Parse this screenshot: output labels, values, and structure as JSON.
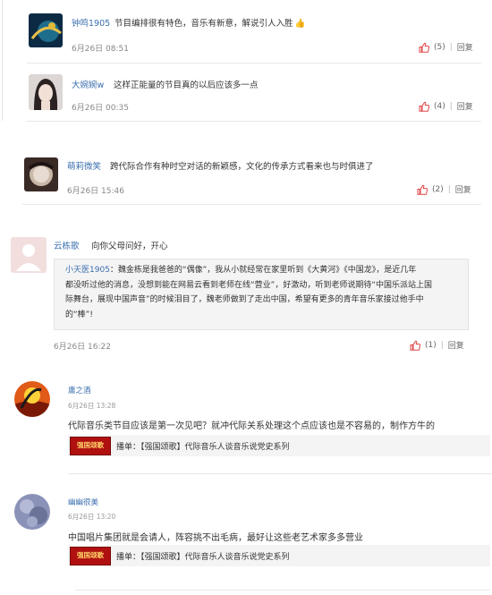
{
  "comments": [
    {
      "user": "钟鸣1905",
      "text": "节目编排很有特色，音乐有新意，解说引人入胜",
      "date": "6月26日 08:51",
      "likes": "(5)",
      "reply": "回复"
    },
    {
      "user": "大婉婉w",
      "text": "这样正能量的节目真的以后应该多一点",
      "date": "6月26日 00:35",
      "likes": "(4)",
      "reply": "回复"
    },
    {
      "user": "萌莉微笑",
      "text": "跨代际合作有种时空对话的新颖感，文化的传承方式看来也与时俱进了",
      "date": "6月26日 15:46",
      "likes": "(2)",
      "reply": "回复"
    },
    {
      "user": "云栋歌",
      "text": "向你父母问好，开心",
      "date": "6月26日 16:22",
      "likes": "(1)",
      "reply": "回复",
      "quote": {
        "user": "小天医1905",
        "lines": [
          "魏金栋是我爸爸的“偶像”，我从小就经常在家里听到《大黄河》《中国龙》，是近几年",
          "都没听过他的消息，没想到能在网易云看到老师在线“营业”，好激动，听到老师说期待“中国乐派站上国",
          "际舞台，展现中国声音”的时候泪目了，魏老师做到了走出中国，希望有更多的青年音乐家接过他手中",
          "的“棒”!"
        ]
      }
    }
  ],
  "threads": [
    {
      "user": "庸之酒",
      "date": "6月26日 13:28",
      "text": "代际音乐类节目应该是第一次见吧？就冲代际关系处理这个点应该也是不容易的，制作方牛的",
      "track_prefix": "播单：",
      "track_title": "【强国颂歌】代际音乐人谈音乐说党史系列",
      "logo_text": "强国颂歌"
    },
    {
      "user": "幽幽很美",
      "date": "6月26日 13:20",
      "text": "中国唱片集团就是会请人，阵容挑不出毛病，最好让这些老艺术家多多营业",
      "track_prefix": "播单：",
      "track_title": "【强国颂歌】代际音乐人谈音乐说党史系列",
      "logo_text": "强国颂歌"
    }
  ],
  "colors": {
    "link": "#3b6fae",
    "like": "#e04444",
    "logo_red": "#b01010"
  }
}
